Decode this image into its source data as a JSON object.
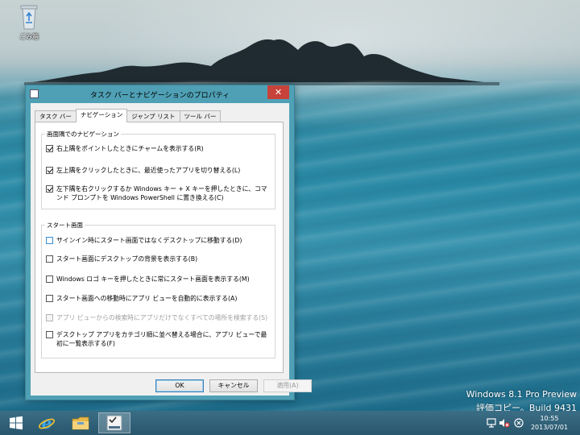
{
  "desktop": {
    "recycle_bin_label": "ごみ箱",
    "watermark_line1": "Windows 8.1 Pro Preview",
    "watermark_line2": "評価コピー。Build 9431"
  },
  "dialog": {
    "title": "タスク バーとナビゲーションのプロパティ",
    "close_glyph": "✕",
    "tabs": [
      {
        "label": "タスク バー",
        "active": false
      },
      {
        "label": "ナビゲーション",
        "active": true
      },
      {
        "label": "ジャンプ リスト",
        "active": false
      },
      {
        "label": "ツール バー",
        "active": false
      }
    ],
    "corner_nav_group": {
      "title": "画面隅でのナビゲーション",
      "options": [
        {
          "label": "右上隅をポイントしたときにチャームを表示する(R)",
          "checked": true
        },
        {
          "label": "左上隅をクリックしたときに、最近使ったアプリを切り替える(L)",
          "checked": true
        },
        {
          "label": "左下隅を右クリックするか Windows キー + X キーを押したときに、コマンド プロンプトを Windows PowerShell に置き換える(C)",
          "checked": true
        }
      ]
    },
    "start_group": {
      "title": "スタート画面",
      "options": [
        {
          "label": "サインイン時にスタート画面ではなくデスクトップに移動する(D)",
          "checked": false
        },
        {
          "label": "スタート画面にデスクトップの背景を表示する(B)",
          "checked": false
        },
        {
          "label": "Windows ロゴ キーを押したときに常にスタート画面を表示する(M)",
          "checked": false
        },
        {
          "label": "スタート画面への移動時にアプリ ビューを自動的に表示する(A)",
          "checked": false
        },
        {
          "label": "アプリ ビューからの検索時にアプリだけでなくすべての場所を検索する(S)",
          "checked": false,
          "disabled": true
        },
        {
          "label": "デスクトップ アプリをカテゴリ順に並べ替える場合に、アプリ ビューで最初に一覧表示する(F)",
          "checked": false
        }
      ]
    },
    "buttons": {
      "ok": "OK",
      "cancel": "キャンセル",
      "apply": "適用(A)"
    }
  },
  "taskbar": {
    "clock_time": "10:55",
    "clock_date": "2013/07/01",
    "pinned": [
      "start-icon",
      "internet-explorer-icon",
      "file-explorer-icon",
      "taskbar-properties-icon"
    ]
  },
  "colors": {
    "dialog_frame": "#4fa0b5",
    "close_button": "#c7423a",
    "taskbar": "#28566c"
  }
}
